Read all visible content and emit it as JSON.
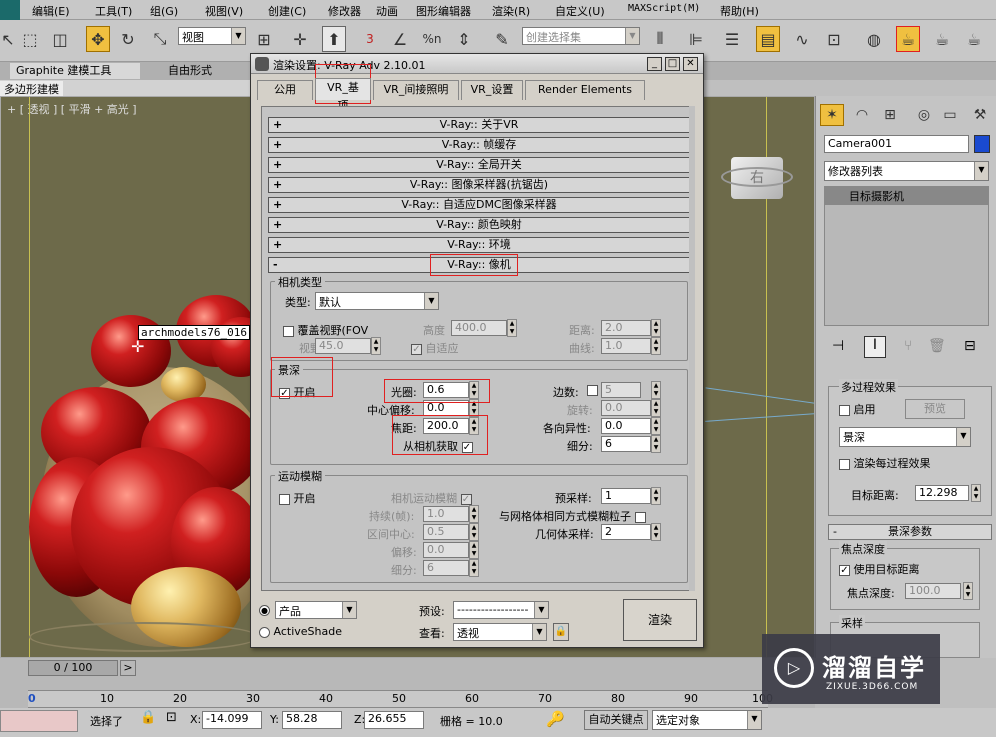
{
  "menubar": {
    "items": [
      "编辑(E)",
      "工具(T)",
      "组(G)",
      "视图(V)",
      "创建(C)",
      "修改器",
      "动画",
      "图形编辑器",
      "渲染(R)",
      "自定义(U)",
      "MAXScript(M)",
      "帮助(H)"
    ]
  },
  "toolbar": {
    "view_dropdown": "视图",
    "selection_set_placeholder": "创建选择集",
    "number_3": "3",
    "percent": "%n"
  },
  "ribbon": {
    "tabs": [
      "Graphite 建模工具",
      "自由形式"
    ],
    "subtab": "多边形建模"
  },
  "viewport": {
    "label": "+ [ 透视 ] [ 平滑 + 高光 ]",
    "object_label": "archmodels76_016",
    "viewcube_label": "右"
  },
  "dialog": {
    "title": "渲染设置: V-Ray Adv 2.10.01",
    "tabs": [
      "公用",
      "VR_基项",
      "VR_间接照明",
      "VR_设置",
      "Render Elements"
    ],
    "rollouts": [
      {
        "sign": "+",
        "label": "V-Ray:: 关于VR"
      },
      {
        "sign": "+",
        "label": "V-Ray:: 帧缓存"
      },
      {
        "sign": "+",
        "label": "V-Ray:: 全局开关"
      },
      {
        "sign": "+",
        "label": "V-Ray:: 图像采样器(抗锯齿)"
      },
      {
        "sign": "+",
        "label": "V-Ray:: 自适应DMC图像采样器"
      },
      {
        "sign": "+",
        "label": "V-Ray:: 颜色映射"
      },
      {
        "sign": "+",
        "label": "V-Ray:: 环境"
      },
      {
        "sign": "-",
        "label": "V-Ray:: 像机"
      }
    ],
    "camera_type": {
      "group": "相机类型",
      "type_label": "类型:",
      "type_value": "默认",
      "override_fov": "覆盖视野(FOV",
      "fov_label": "视野",
      "fov_value": "45.0",
      "height_label": "高度",
      "height_value": "400.0",
      "auto_label": "自适应",
      "distance_label": "距离:",
      "distance_value": "2.0",
      "curve_label": "曲线:",
      "curve_value": "1.0"
    },
    "dof": {
      "group": "景深",
      "on_label": "开启",
      "aperture_label": "光圈:",
      "aperture_value": "0.6",
      "center_bias_label": "中心偏移:",
      "center_bias_value": "0.0",
      "focal_label": "焦距:",
      "focal_value": "200.0",
      "from_camera_label": "从相机获取",
      "sides_label": "边数:",
      "sides_value": "5",
      "rotation_label": "旋转:",
      "rotation_value": "0.0",
      "aniso_label": "各向异性:",
      "aniso_value": "0.0",
      "subdiv_label": "细分:",
      "subdiv_value": "6"
    },
    "motion_blur": {
      "group": "运动模糊",
      "on_label": "开启",
      "cam_mb_label": "相机运动模糊",
      "duration_label": "持续(帧):",
      "duration_value": "1.0",
      "interval_label": "区间中心:",
      "interval_value": "0.5",
      "bias_label": "偏移:",
      "bias_value": "0.0",
      "subdiv_label": "细分:",
      "subdiv_value": "6",
      "presample_label": "预采样:",
      "presample_value": "1",
      "particles_label": "与网格体相同方式模糊粒子",
      "geo_label": "几何体采样:",
      "geo_value": "2"
    },
    "bottom": {
      "mode_product": "产品",
      "mode_activeshade": "ActiveShade",
      "preset_label": "预设:",
      "preset_value": "------------------",
      "view_label": "查看:",
      "view_value": "透视",
      "render_button": "渲染"
    }
  },
  "rightpanel": {
    "object_name": "Camera001",
    "modifier_list": "修改器列表",
    "stack_item": "目标摄影机",
    "multipass_group": "多过程效果",
    "enable_label": "启用",
    "preview_button": "预览",
    "effect_dropdown": "景深",
    "render_each_label": "渲染每过程效果",
    "target_dist_label": "目标距离:",
    "target_dist_value": "12.298",
    "dof_params": "景深参数",
    "focal_depth_group": "焦点深度",
    "use_target_label": "使用目标距离",
    "focal_depth_label": "焦点深度:",
    "focal_depth_value": "100.0",
    "sampling_group": "采样"
  },
  "timeline": {
    "frame": "0 / 100",
    "ticks": [
      "0",
      "10",
      "20",
      "30",
      "40",
      "50",
      "60",
      "70",
      "80",
      "90",
      "100"
    ]
  },
  "status": {
    "selected": "选择了",
    "x_label": "X:",
    "x_value": "-14.099",
    "y_label": "Y:",
    "y_value": "58.28",
    "z_label": "Z:",
    "z_value": "26.655",
    "grid": "栅格 = 10.0",
    "autokey": "自动关键点",
    "selected_object": "选定对象"
  },
  "watermark": {
    "brand": "溜溜自学",
    "url": "ZIXUE.3D66.COM"
  },
  "colors": {
    "highlight": "#e02020",
    "accent": "#f0c040"
  }
}
